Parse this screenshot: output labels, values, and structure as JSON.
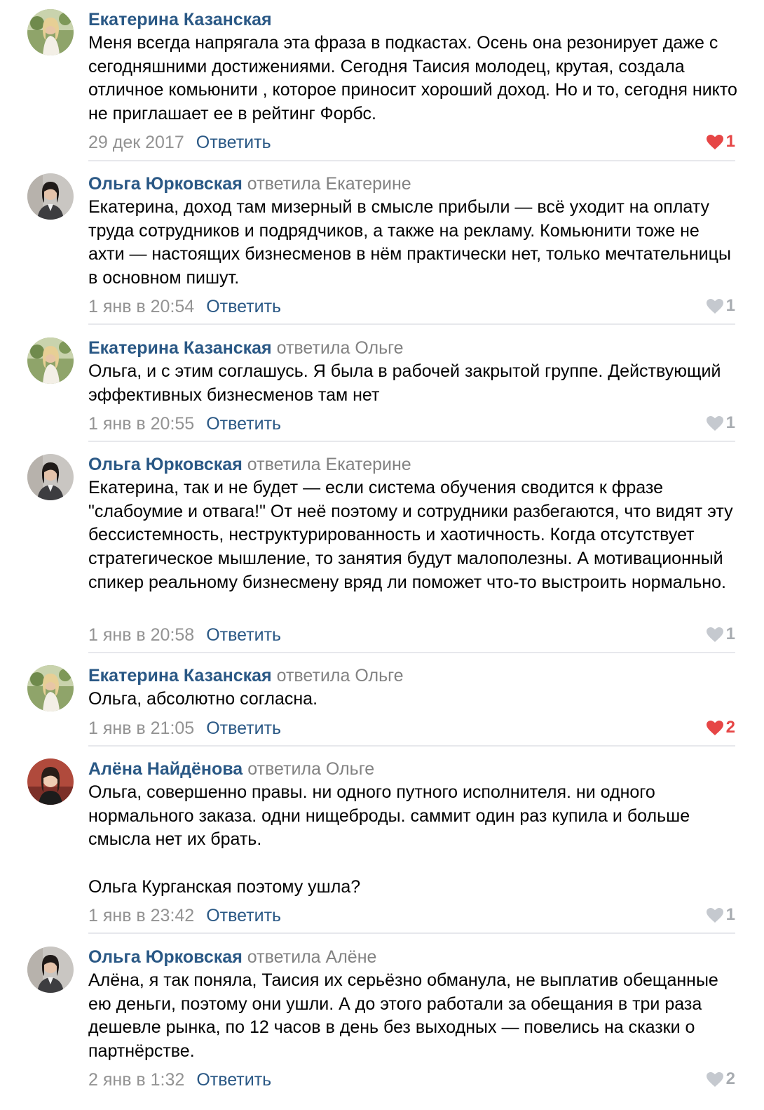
{
  "colors": {
    "author": "#2a5885",
    "muted": "#939393",
    "like_active": "#e64646",
    "like_inactive": "#c5c9cf",
    "divider": "#e7e8ec"
  },
  "comments": [
    {
      "author": "Екатерина Казанская",
      "reply_to": "",
      "text": "Меня всегда напрягала эта фраза в подкастах. Осень она резонирует даже с сегодняшними достижениями. Сегодня Таисия молодец, крутая, создала отличное комьюнити , которое приносит хороший доход. Но и то, сегодня никто не приглашает ее в рейтинг Форбс.",
      "date": "29 дек 2017",
      "reply_label": "Ответить",
      "likes": "1",
      "liked": true,
      "avatar": "avatar-ekaterina"
    },
    {
      "author": "Ольга Юрковская",
      "reply_to": "ответила Екатерине",
      "text": "Екатерина, доход там мизерный в смысле прибыли — всё уходит на оплату труда сотрудников и подрядчиков, а также на рекламу. Комьюнити тоже не ахти — настоящих бизнесменов в нём практически нет, только мечтательницы в основном пишут.",
      "date": "1 янв в 20:54",
      "reply_label": "Ответить",
      "likes": "1",
      "liked": false,
      "avatar": "avatar-olga"
    },
    {
      "author": "Екатерина Казанская",
      "reply_to": "ответила Ольге",
      "text": "Ольга, и с этим соглашусь. Я была в рабочей закрытой группе. Действующий эффективных бизнесменов там нет",
      "date": "1 янв в 20:55",
      "reply_label": "Ответить",
      "likes": "1",
      "liked": false,
      "avatar": "avatar-ekaterina"
    },
    {
      "author": "Ольга Юрковская",
      "reply_to": "ответила Екатерине",
      "text": "Екатерина, так и не будет — если система обучения сводится к фразе \"слабоумие и отвага!\" От неё поэтому и сотрудники разбегаются, что видят эту бессистемность, неструктурированность и хаотичность. Когда отсутствует стратегическое мышление, то занятия будут малополезны. А мотивационный спикер реальному бизнесмену вряд ли поможет что-то выстроить нормально.",
      "date": "1 янв в 20:58",
      "reply_label": "Ответить",
      "likes": "1",
      "liked": false,
      "avatar": "avatar-olga"
    },
    {
      "author": "Екатерина Казанская",
      "reply_to": "ответила Ольге",
      "text": "Ольга, абсолютно согласна.",
      "date": "1 янв в 21:05",
      "reply_label": "Ответить",
      "likes": "2",
      "liked": true,
      "avatar": "avatar-ekaterina"
    },
    {
      "author": "Алёна Найдёнова",
      "reply_to": "ответила Ольге",
      "text": "Ольга, совершенно правы. ни одного путного исполнителя. ни одного нормального заказа. одни нищеброды. саммит один раз купила и больше смысла нет их брать.\n\nОльга Курганская поэтому ушла?",
      "date": "1 янв в 23:42",
      "reply_label": "Ответить",
      "likes": "1",
      "liked": false,
      "avatar": "avatar-alena"
    },
    {
      "author": "Ольга Юрковская",
      "reply_to": "ответила Алёне",
      "text": "Алёна, я так поняла, Таисия их серьёзно обманула, не выплатив обещанные ею деньги, поэтому они ушли. А до этого работали за обещания в три раза дешевле рынка, по 12 часов в день без выходных — повелись на сказки о партнёрстве.",
      "date": "2 янв в 1:32",
      "reply_label": "Ответить",
      "likes": "2",
      "liked": false,
      "avatar": "avatar-olga"
    }
  ]
}
